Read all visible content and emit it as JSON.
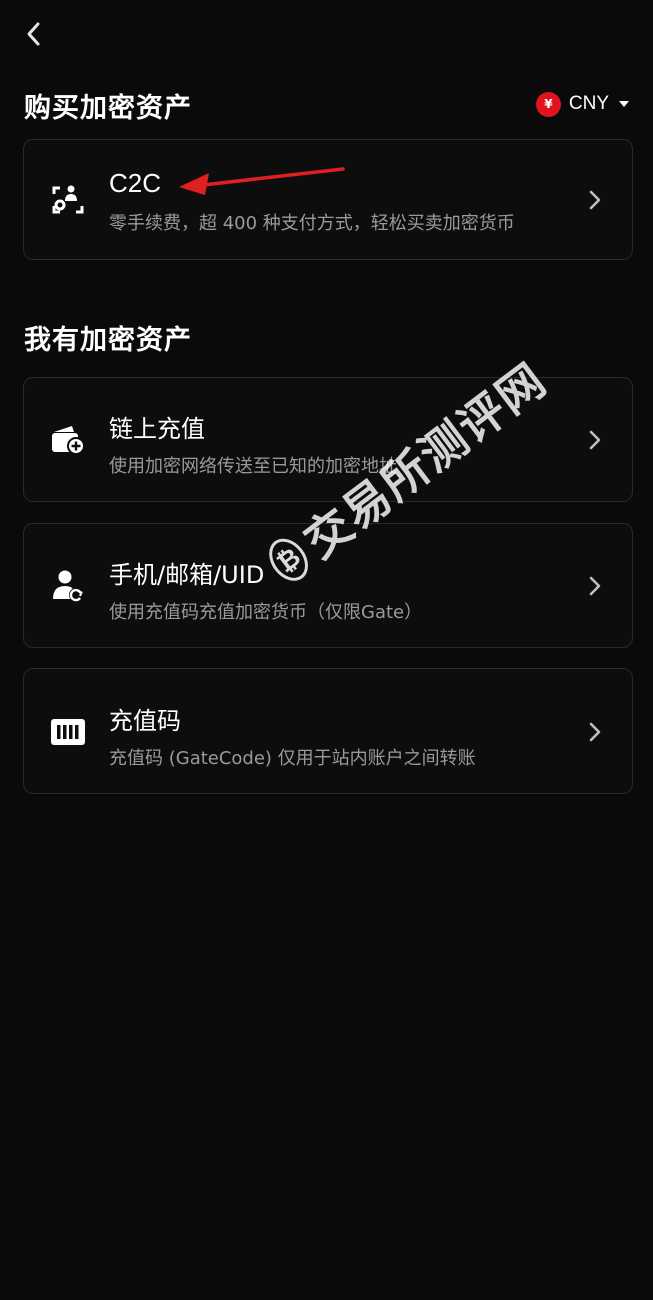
{
  "nav": {
    "back_icon": "chevron-left-icon"
  },
  "buy_section": {
    "title": "购买加密资产",
    "currency": {
      "symbol": "¥",
      "label": "CNY",
      "badge_color": "#e0141e"
    },
    "cards": [
      {
        "title": "C2C",
        "description": "零手续费，超 400 种支付方式，轻松买卖加密货币",
        "icon": "c2c-icon"
      }
    ]
  },
  "have_section": {
    "title": "我有加密资产",
    "cards": [
      {
        "title": "链上充值",
        "description": "使用加密网络传送至已知的加密地址",
        "icon": "wallet-add-icon"
      },
      {
        "title": "手机/邮箱/UID",
        "description": "使用充值码充值加密货币（仅限Gate）",
        "icon": "user-refresh-icon"
      },
      {
        "title": "充值码",
        "description": "充值码 (GateCode) 仅用于站内账户之间转账",
        "icon": "barcode-icon"
      }
    ]
  },
  "watermark": {
    "text": "交易所测评网"
  },
  "annotation": {
    "arrow_color": "#e02020"
  }
}
